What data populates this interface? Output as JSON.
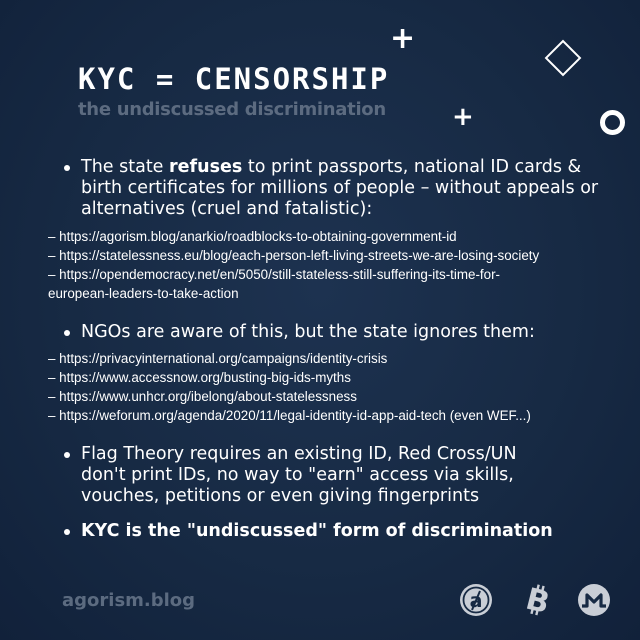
{
  "header": {
    "title": "KYC = CENSORSHIP",
    "subtitle": "the undiscussed discrimination"
  },
  "bullets": [
    {
      "pre": "The state ",
      "bold": "refuses",
      "post": " to print passports, national ID cards & birth certificates for millions of people – without appeals or alternatives (cruel and fatalistic):"
    },
    {
      "pre": "NGOs are aware of this, but the state ignores them:",
      "bold": "",
      "post": ""
    },
    {
      "pre": "Flag Theory requires an existing ID, Red Cross/UN don't print IDs, no way to \"earn\" access via skills, vouches, petitions or even giving fingerprints",
      "bold": "",
      "post": ""
    },
    {
      "pre": "KYC is the \"undiscussed\" form of discrimination",
      "bold": "",
      "post": ""
    }
  ],
  "links_group1": [
    "– https://agorism.blog/anarkio/roadblocks-to-obtaining-government-id",
    "– https://statelessness.eu/blog/each-person-left-living-streets-we-are-losing-society",
    "– https://opendemocracy.net/en/5050/still-stateless-still-suffering-its-time-for-",
    "european-leaders-to-take-action"
  ],
  "links_group2": [
    "– https://privacyinternational.org/campaigns/identity-crisis",
    "– https://www.accessnow.org/busting-big-ids-myths",
    "– https://www.unhcr.org/ibelong/about-statelessness",
    "– https://weforum.org/agenda/2020/11/legal-identity-id-app-aid-tech (even WEF...)"
  ],
  "footer": {
    "brand": "agorism.blog"
  },
  "icons": {
    "agorism": "agorism-logo-icon",
    "bitcoin": "bitcoin-icon",
    "monero": "monero-icon"
  },
  "colors": {
    "background": "#172a44",
    "muted_text": "#5c6b80",
    "text": "#ffffff",
    "logo_gray": "#c9ced6"
  }
}
